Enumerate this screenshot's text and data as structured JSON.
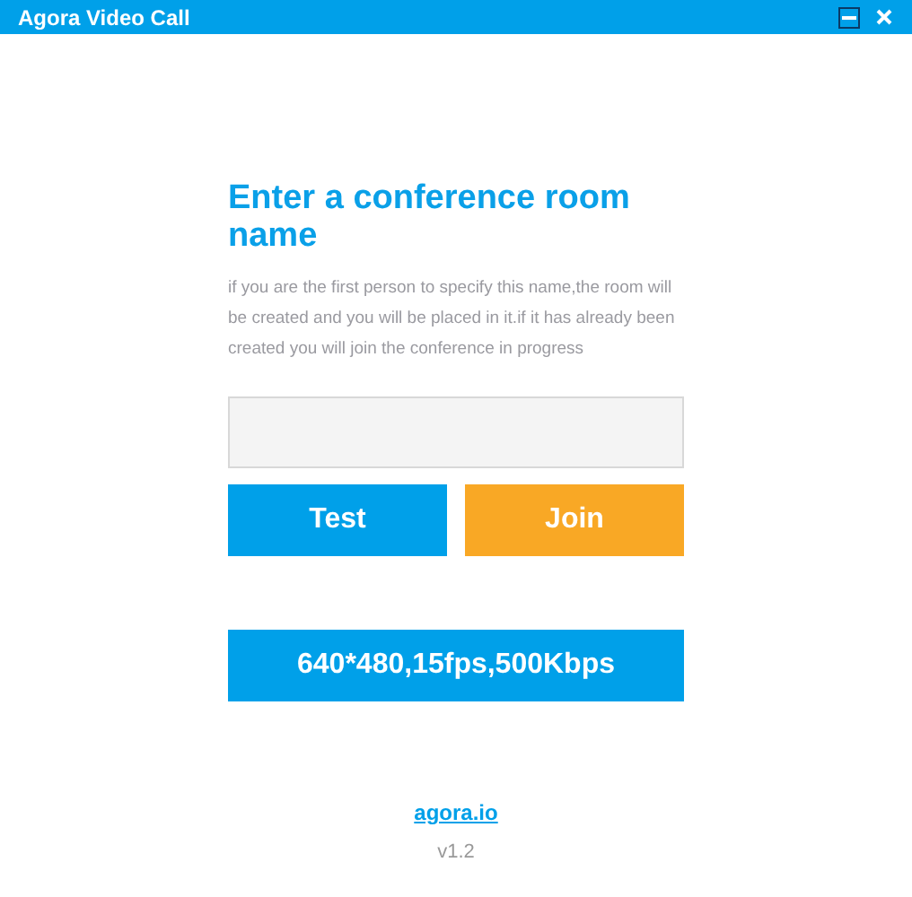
{
  "window": {
    "title": "Agora Video Call"
  },
  "heading": "Enter a conference room name",
  "description": "if you are the first person to specify this name,the room will be created and you will be placed in it.if it has already been created you will join the conference in progress",
  "buttons": [
    {
      "label": "Test",
      "kind": "test"
    },
    {
      "label": "Join",
      "kind": "join"
    }
  ],
  "profile_button": "640*480,15fps,500Kbps",
  "link": "agora.io",
  "version": "v1.2"
}
